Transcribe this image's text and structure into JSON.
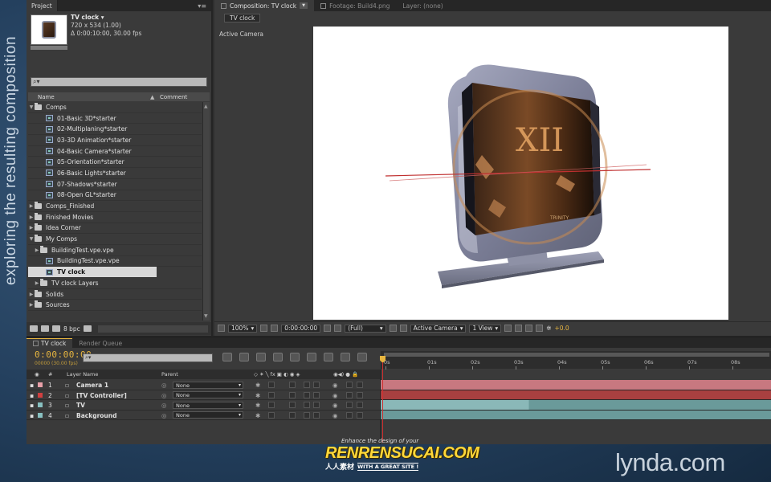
{
  "side_caption": "exploring the resulting composition",
  "project": {
    "tab_label": "Project",
    "selected_name": "TV clock ▾",
    "selected_info": [
      "720 x 534 (1.00)",
      "Δ 0:00:10:00, 30.00 fps"
    ],
    "columns": {
      "name": "Name",
      "comment": "Comment"
    },
    "items": [
      {
        "label": "Comps",
        "type": "folder",
        "open": true,
        "indent": 0
      },
      {
        "label": "01-Basic 3D*starter",
        "type": "comp",
        "indent": 2
      },
      {
        "label": "02-Multiplaning*starter",
        "type": "comp",
        "indent": 2
      },
      {
        "label": "03-3D Animation*starter",
        "type": "comp",
        "indent": 2
      },
      {
        "label": "04-Basic Camera*starter",
        "type": "comp",
        "indent": 2
      },
      {
        "label": "05-Orientation*starter",
        "type": "comp",
        "indent": 2
      },
      {
        "label": "06-Basic Lights*starter",
        "type": "comp",
        "indent": 2
      },
      {
        "label": "07-Shadows*starter",
        "type": "comp",
        "indent": 2
      },
      {
        "label": "08-Open GL*starter",
        "type": "comp",
        "indent": 2
      },
      {
        "label": "Comps_Finished",
        "type": "folder",
        "open": false,
        "indent": 0
      },
      {
        "label": "Finished Movies",
        "type": "folder",
        "open": false,
        "indent": 0
      },
      {
        "label": "Idea Corner",
        "type": "folder",
        "open": false,
        "indent": 0
      },
      {
        "label": "My Comps",
        "type": "folder",
        "open": true,
        "indent": 0
      },
      {
        "label": "BuildingTest.vpe.vpe",
        "type": "folder",
        "open": false,
        "indent": 1
      },
      {
        "label": "BuildingTest.vpe.vpe",
        "type": "comp",
        "indent": 2
      },
      {
        "label": "TV clock",
        "type": "comp",
        "indent": 2,
        "selected": true
      },
      {
        "label": "TV clock Layers",
        "type": "folder",
        "open": false,
        "indent": 1
      },
      {
        "label": "Solids",
        "type": "folder",
        "open": false,
        "indent": 0
      },
      {
        "label": "Sources",
        "type": "folder",
        "open": false,
        "indent": 0
      }
    ],
    "bpc_label": "8 bpc"
  },
  "composition": {
    "tabs": [
      {
        "label": "Composition: TV clock",
        "active": true
      },
      {
        "label": "Footage: Build4.png",
        "active": false
      },
      {
        "label": "Layer: (none)",
        "active": false
      }
    ],
    "subtab": "TV clock",
    "view_label": "Active Camera",
    "toolbar": {
      "zoom": "100%",
      "timecode": "0:00:00:00",
      "resolution": "(Full)",
      "camera": "Active Camera",
      "views": "1 View",
      "exposure": "+0.0"
    },
    "tv_brand": "TRINITY",
    "clock_numerals": "XII"
  },
  "timeline": {
    "tabs": [
      {
        "label": "TV clock",
        "active": true
      },
      {
        "label": "Render Queue",
        "active": false
      }
    ],
    "timecode": "0:00:00:00",
    "fps": "00000 (30.00 fps)",
    "headers": {
      "num": "#",
      "layer_name": "Layer Name",
      "parent": "Parent"
    },
    "layers": [
      {
        "num": "1",
        "name": "Camera 1",
        "color": "#e8a0a8",
        "parent": "None",
        "bar_color": "#c87880"
      },
      {
        "num": "2",
        "name": "[TV Controller]",
        "color": "#d04040",
        "parent": "None",
        "bar_color": "#a84040"
      },
      {
        "num": "3",
        "name": "TV",
        "color": "#88c0c0",
        "parent": "None",
        "bar_color": "#6a9a9a"
      },
      {
        "num": "4",
        "name": "Background",
        "color": "#88c0c0",
        "parent": "None",
        "bar_color": "#6a9a9a"
      }
    ],
    "ruler_ticks": [
      "0s",
      "01s",
      "02s",
      "03s",
      "04s",
      "05s",
      "06s",
      "07s",
      "08s"
    ]
  },
  "branding": {
    "lynda": "lynda.com",
    "watermark_top": "Enhance the design of your",
    "watermark_main": "RENRENSUCAI.COM",
    "watermark_cn": "人人素材",
    "watermark_tag": "WITH A GREAT SITE !"
  }
}
